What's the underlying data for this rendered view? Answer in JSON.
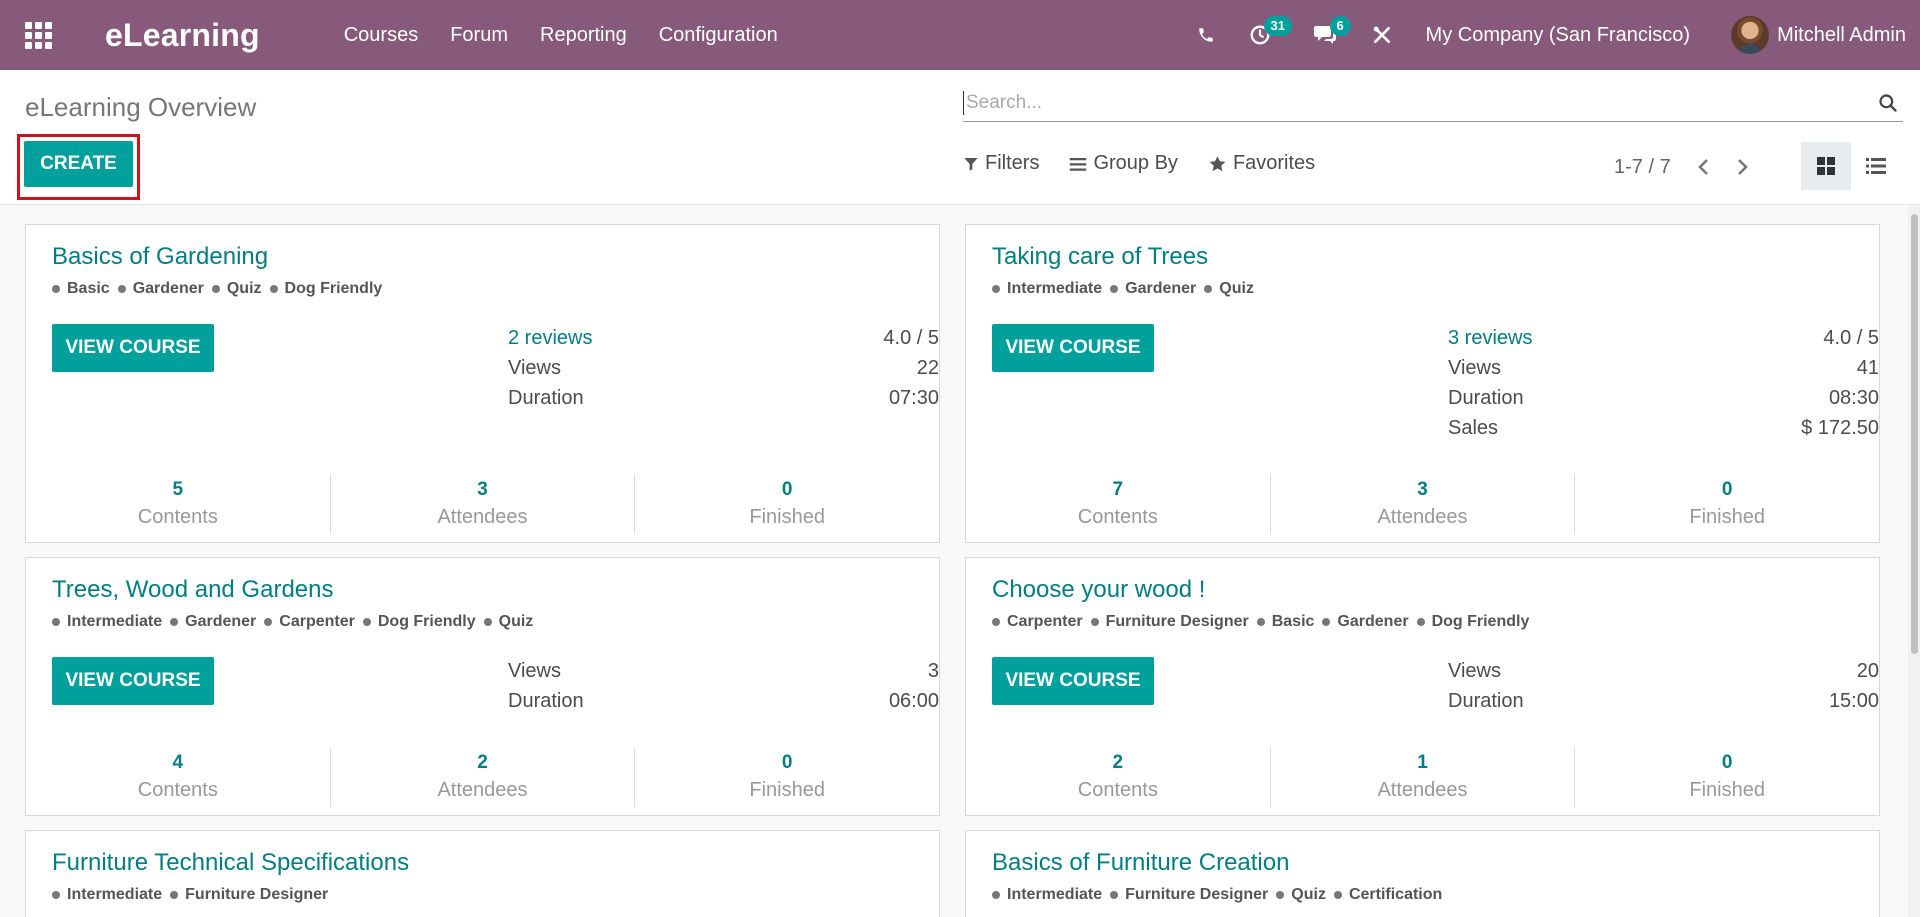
{
  "app": {
    "brand": "eLearning",
    "menu": [
      "Courses",
      "Forum",
      "Reporting",
      "Configuration"
    ],
    "activity_count": "31",
    "message_count": "6",
    "company": "My Company (San Francisco)",
    "user_name": "Mitchell Admin"
  },
  "control_panel": {
    "breadcrumb": "eLearning Overview",
    "create_label": "CREATE",
    "search_placeholder": "Search...",
    "filters_label": "Filters",
    "group_by_label": "Group By",
    "favorites_label": "Favorites",
    "pager": "1-7 / 7"
  },
  "course_labels": {
    "view_course": "VIEW COURSE",
    "contents": "Contents",
    "attendees": "Attendees",
    "finished": "Finished"
  },
  "courses": [
    {
      "title": "Basics of Gardening",
      "tags": [
        "Basic",
        "Gardener",
        "Quiz",
        "Dog Friendly"
      ],
      "stats": [
        {
          "label": "2 reviews",
          "value": "4.0 / 5",
          "link": true
        },
        {
          "label": "Views",
          "value": "22"
        },
        {
          "label": "Duration",
          "value": "07:30"
        }
      ],
      "contents": "5",
      "attendees": "3",
      "finished": "0"
    },
    {
      "title": "Taking care of Trees",
      "tags": [
        "Intermediate",
        "Gardener",
        "Quiz"
      ],
      "stats": [
        {
          "label": "3 reviews",
          "value": "4.0 / 5",
          "link": true
        },
        {
          "label": "Views",
          "value": "41"
        },
        {
          "label": "Duration",
          "value": "08:30"
        },
        {
          "label": "Sales",
          "value": "$ 172.50"
        }
      ],
      "contents": "7",
      "attendees": "3",
      "finished": "0"
    },
    {
      "title": "Trees, Wood and Gardens",
      "tags": [
        "Intermediate",
        "Gardener",
        "Carpenter",
        "Dog Friendly",
        "Quiz"
      ],
      "stats": [
        {
          "label": "Views",
          "value": "3"
        },
        {
          "label": "Duration",
          "value": "06:00"
        }
      ],
      "contents": "4",
      "attendees": "2",
      "finished": "0"
    },
    {
      "title": "Choose your wood !",
      "tags": [
        "Carpenter",
        "Furniture Designer",
        "Basic",
        "Gardener",
        "Dog Friendly"
      ],
      "stats": [
        {
          "label": "Views",
          "value": "20"
        },
        {
          "label": "Duration",
          "value": "15:00"
        }
      ],
      "contents": "2",
      "attendees": "1",
      "finished": "0"
    },
    {
      "title": "Furniture Technical Specifications",
      "tags": [
        "Intermediate",
        "Furniture Designer"
      ],
      "stats": [],
      "contents": "",
      "attendees": "",
      "finished": ""
    },
    {
      "title": "Basics of Furniture Creation",
      "tags": [
        "Intermediate",
        "Furniture Designer",
        "Quiz",
        "Certification"
      ],
      "stats": [],
      "contents": "",
      "attendees": "",
      "finished": ""
    }
  ],
  "colors": {
    "navbar": "#875a7b",
    "primary": "#00a09d",
    "link": "#017e84",
    "highlight_border": "#d0121f"
  },
  "icons": [
    "apps-menu-icon",
    "phone-icon",
    "activity-clock-icon",
    "chat-icon",
    "tools-icon",
    "search-icon",
    "filter-icon",
    "group-by-icon",
    "star-icon",
    "chevron-left-icon",
    "chevron-right-icon",
    "kanban-view-icon",
    "list-view-icon"
  ]
}
